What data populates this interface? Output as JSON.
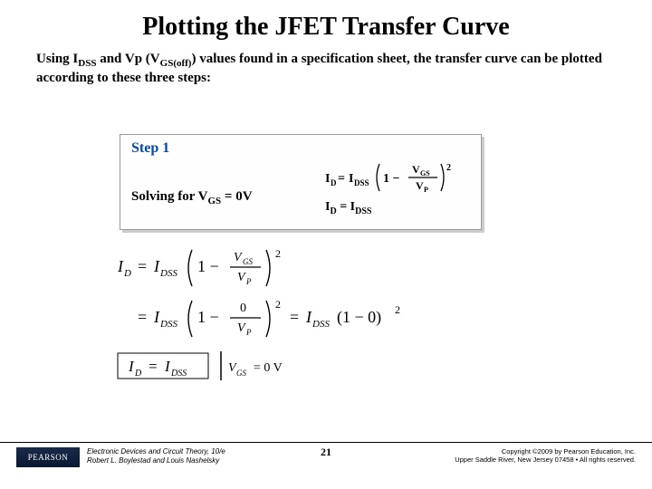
{
  "title": "Plotting the JFET Transfer Curve",
  "intro_html": "Using I<sub>DSS</sub> and Vp (V<sub>GS(off)</sub>) values found in a specification sheet, the transfer curve can be plotted according to these three steps:",
  "step": {
    "label": "Step 1",
    "solving_text_html": "Solving for V<sub>GS</sub> = 0V",
    "result_html": "I<sub>D</sub> = I<sub>DSS</sub>",
    "formula_plain": "ID = IDSS (1 - VGS/VP)^2"
  },
  "derivation": {
    "line1": "I_D = I_DSS (1 - V_GS / V_P)^2",
    "line2": "= I_DSS (1 - 0 / V_P)^2 = I_DSS (1 - 0)^2",
    "boxed": "I_D = I_DSS",
    "cond": "V_GS = 0 V"
  },
  "footer": {
    "logo": "PEARSON",
    "book_title": "Electronic Devices and Circuit Theory, 10/e",
    "authors": "Robert L. Boylestad and Louis Nashelsky",
    "page": "21",
    "copyright_line1": "Copyright ©2009 by Pearson Education, Inc.",
    "copyright_line2": "Upper Saddle River, New Jersey 07458 • All rights reserved."
  }
}
